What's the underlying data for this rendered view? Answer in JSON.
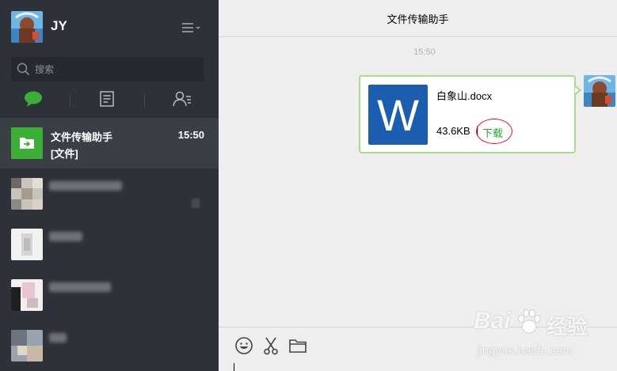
{
  "profile": {
    "name": "JY"
  },
  "search": {
    "placeholder": "搜索"
  },
  "chats": [
    {
      "name": "文件传输助手",
      "time": "15:50",
      "preview": "[文件]",
      "active": true
    }
  ],
  "conversation": {
    "title": "文件传输助手",
    "message_time": "15:50",
    "file": {
      "icon_letter": "W",
      "name": "白象山.docx",
      "size": "43.6KB",
      "separator": "|",
      "download_label": "下载"
    }
  },
  "watermark": {
    "brand_left": "Bai",
    "brand_right": "经验",
    "url": "jingyan.baidu.com"
  },
  "colors": {
    "sidebar_bg": "#2e3238",
    "accent_green": "#27a82a",
    "word_blue": "#1b5eb0",
    "bubble_border": "#a8dd8c",
    "highlight_red": "#e0141e"
  }
}
